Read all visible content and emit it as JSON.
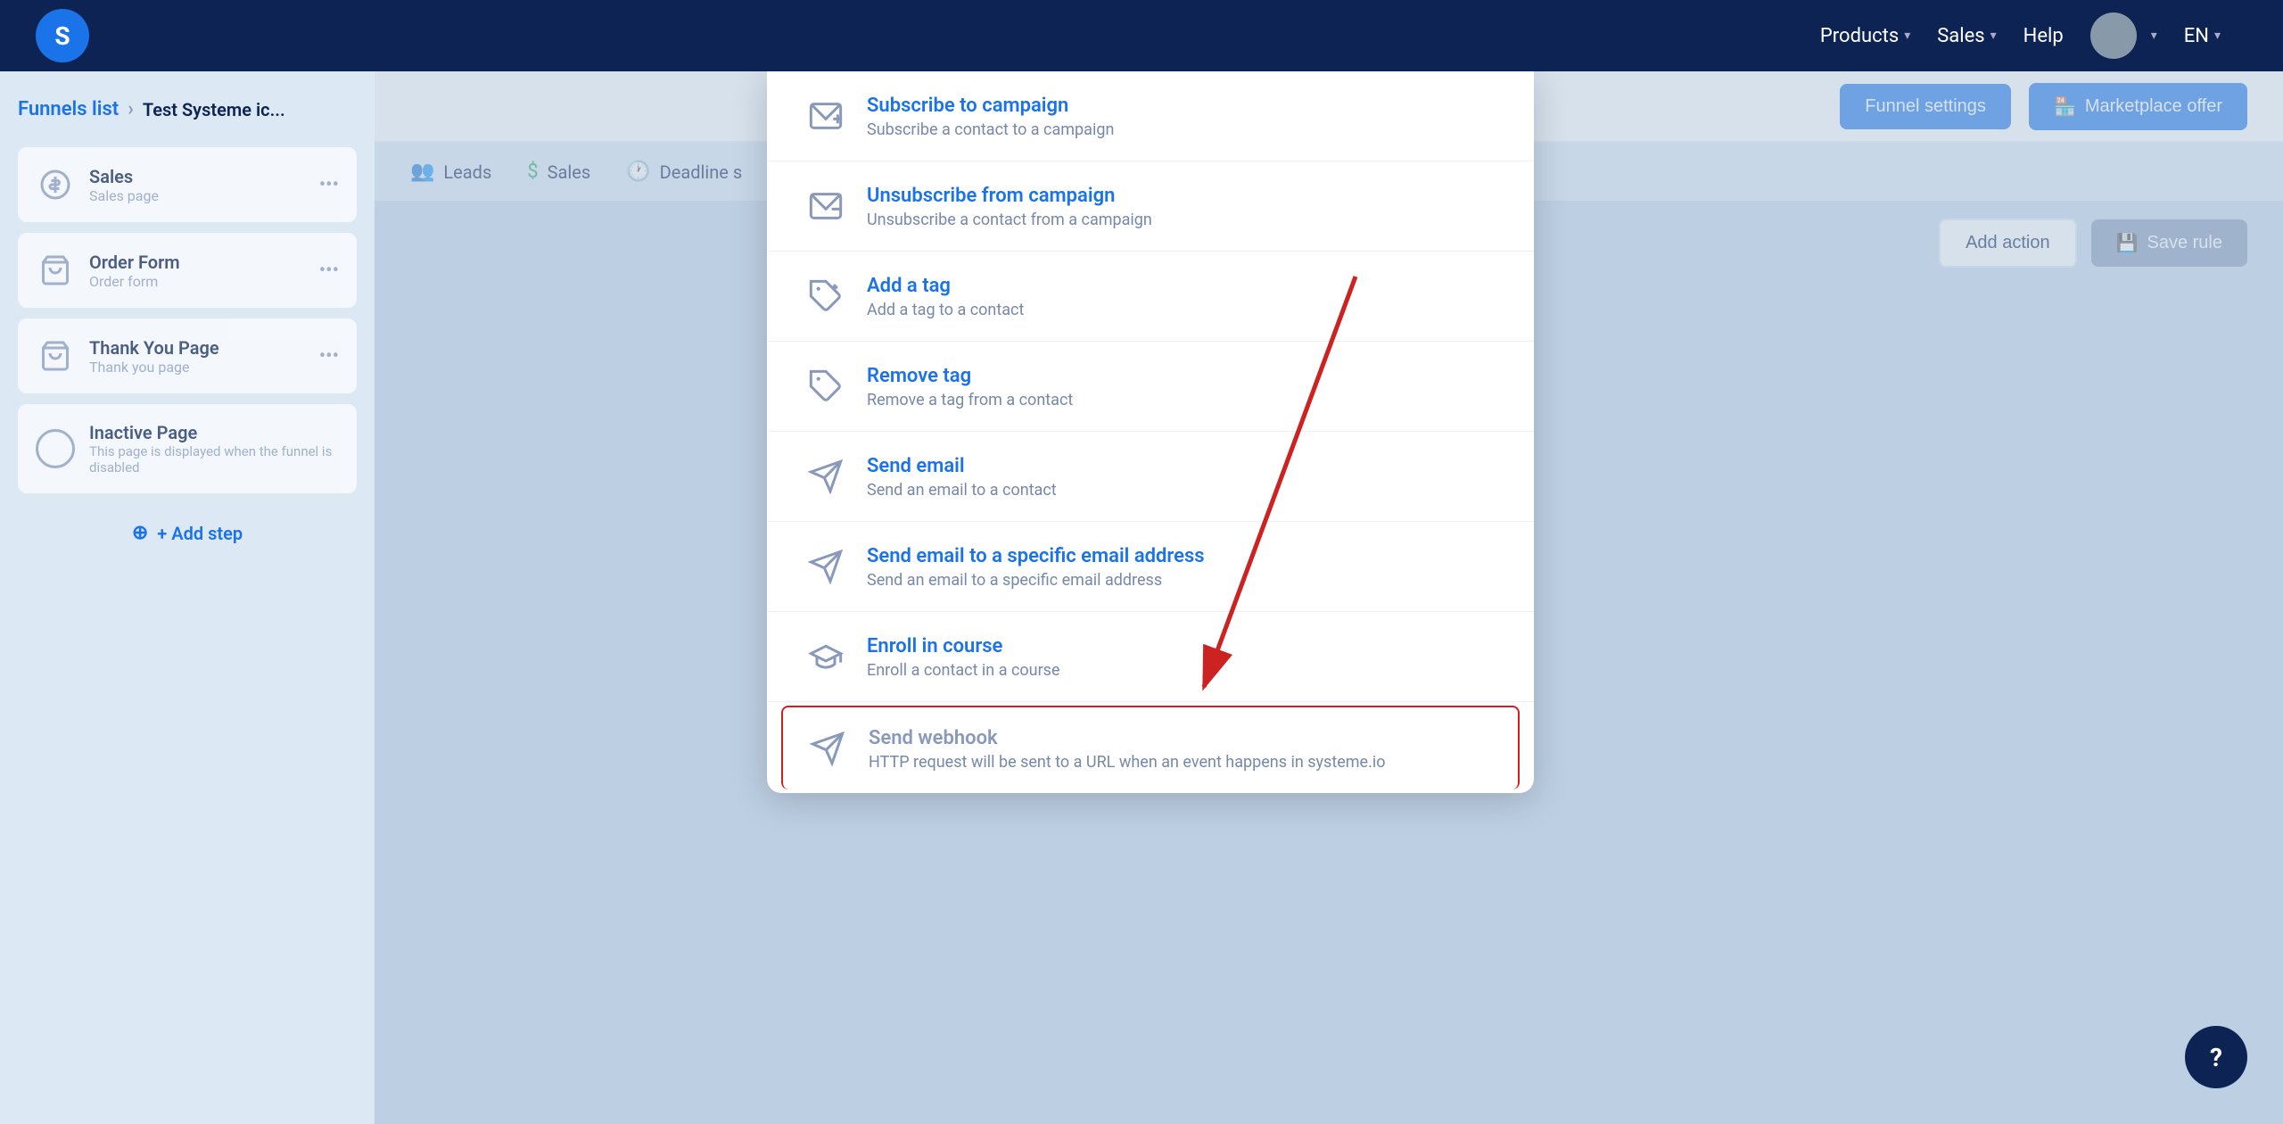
{
  "app": {
    "logo_letter": "S"
  },
  "nav": {
    "products_label": "Products",
    "sales_label": "Sales",
    "help_label": "Help",
    "lang_label": "EN"
  },
  "breadcrumb": {
    "part1": "Funnels list",
    "separator": "›",
    "part2": "Test Systeme ic..."
  },
  "sidebar": {
    "items": [
      {
        "title": "Sales",
        "sub": "Sales page",
        "icon": "dollar"
      },
      {
        "title": "Order Form",
        "sub": "Order form",
        "icon": "cart"
      },
      {
        "title": "Thank You Page",
        "sub": "Thank you page",
        "icon": "cart"
      },
      {
        "title": "Inactive Page",
        "sub": "This page is displayed when the funnel is disabled",
        "icon": "circle"
      }
    ],
    "add_step_label": "+ Add step"
  },
  "sub_nav": {
    "funnel_settings_label": "Funnel settings",
    "marketplace_label": "Marketplace offer"
  },
  "stats": [
    {
      "icon": "👥",
      "label": "Leads"
    },
    {
      "icon": "$",
      "label": "Sales"
    },
    {
      "icon": "🕐",
      "label": "Deadline s"
    }
  ],
  "rule_bar": {
    "add_action_label": "Add action",
    "save_rule_label": "Save rule"
  },
  "actions": [
    {
      "id": "subscribe-campaign",
      "title": "Subscribe to campaign",
      "sub": "Subscribe a contact to a campaign",
      "icon": "email-in"
    },
    {
      "id": "unsubscribe-campaign",
      "title": "Unsubscribe from campaign",
      "sub": "Unsubscribe a contact from a campaign",
      "icon": "email-out"
    },
    {
      "id": "add-tag",
      "title": "Add a tag",
      "sub": "Add a tag to a contact",
      "icon": "tag-add"
    },
    {
      "id": "remove-tag",
      "title": "Remove tag",
      "sub": "Remove a tag from a contact",
      "icon": "tag-remove"
    },
    {
      "id": "send-email",
      "title": "Send email",
      "sub": "Send an email to a contact",
      "icon": "send"
    },
    {
      "id": "send-email-specific",
      "title": "Send email to a specific email address",
      "sub": "Send an email to a specific email address",
      "icon": "send"
    },
    {
      "id": "enroll-course",
      "title": "Enroll in course",
      "sub": "Enroll a contact in a course",
      "icon": "graduation"
    },
    {
      "id": "send-webhook",
      "title": "Send webhook",
      "sub": "HTTP request will be sent to a URL when an event happens in systeme.io",
      "icon": "webhook",
      "highlighted": true
    }
  ],
  "help_btn": "?"
}
